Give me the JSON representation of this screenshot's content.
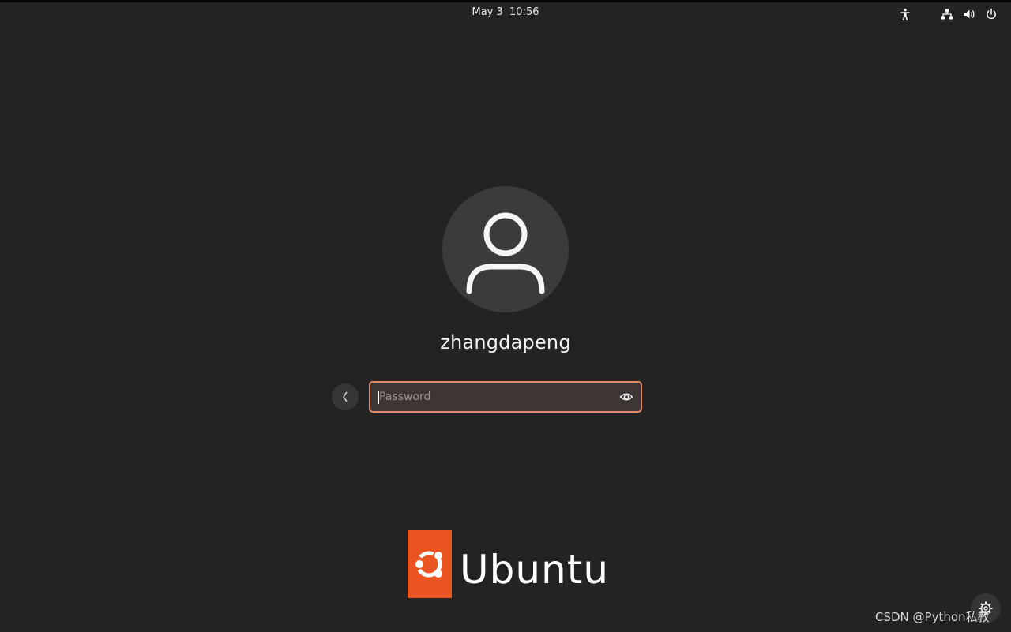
{
  "topbar": {
    "clock": "May 3  10:56",
    "icons": [
      "accessibility-icon",
      "network-icon",
      "volume-icon",
      "power-icon"
    ]
  },
  "login": {
    "username": "zhangdapeng",
    "password_placeholder": "Password",
    "password_value": ""
  },
  "branding": {
    "logo_text": "Ubuntu",
    "accent_color": "#e95420"
  },
  "watermark": "CSDN @Python私教",
  "colors": {
    "background": "#232323",
    "input_border": "#e38a6b",
    "input_background": "#3d3634",
    "avatar_background": "#3b3b3b"
  }
}
